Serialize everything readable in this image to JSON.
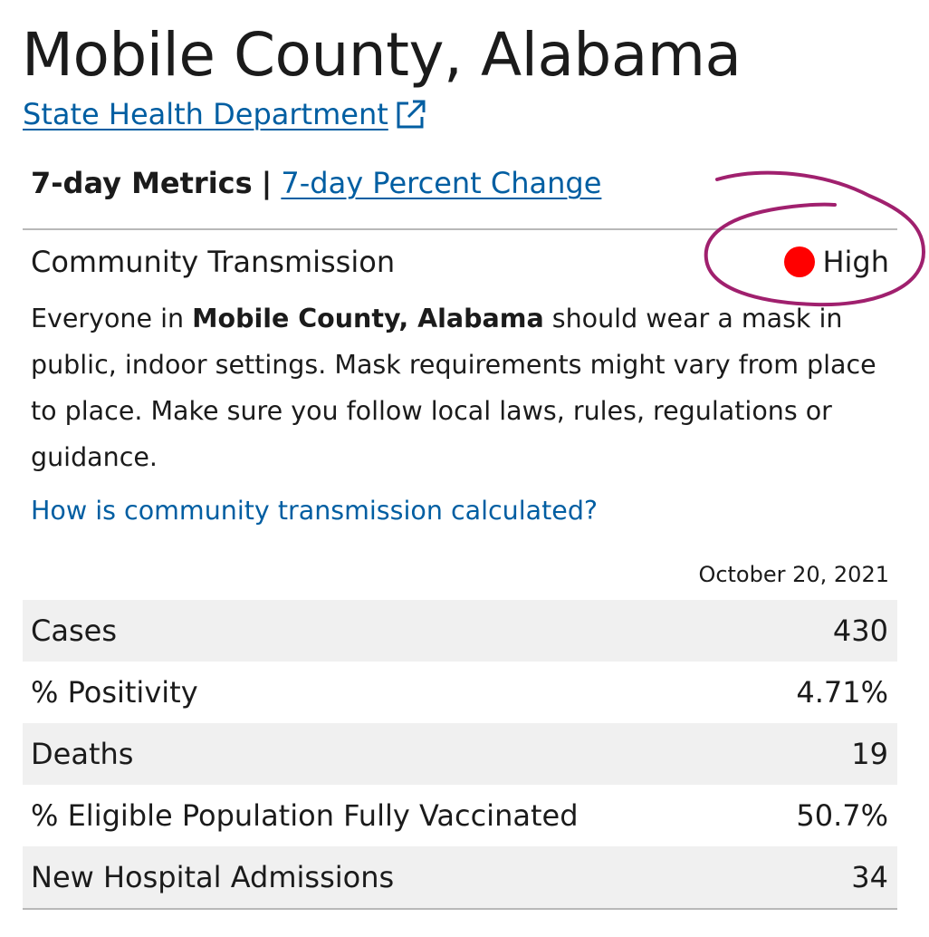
{
  "header": {
    "title": "Mobile County, Alabama",
    "state_link": "State Health Department"
  },
  "tabs": {
    "active": "7-day Metrics",
    "separator": "|",
    "link": "7-day Percent Change"
  },
  "transmission": {
    "label": "Community Transmission",
    "level": "High",
    "level_color": "#ff0000",
    "guidance": {
      "prefix": "Everyone in ",
      "county": "Mobile County, Alabama",
      "suffix": " should wear a mask in public, indoor settings. Mask requirements might vary from place to place. Make sure you follow local laws, rules, regulations or guidance."
    },
    "calc_link": "How is community transmission calculated?"
  },
  "metrics": {
    "date": "October 20, 2021",
    "rows": [
      {
        "label": "Cases",
        "value": "430"
      },
      {
        "label": "% Positivity",
        "value": "4.71%"
      },
      {
        "label": "Deaths",
        "value": "19"
      },
      {
        "label": "% Eligible Population Fully Vaccinated",
        "value": "50.7%"
      },
      {
        "label": "New Hospital Admissions",
        "value": "34"
      }
    ]
  },
  "colors": {
    "link": "#005ea2",
    "annotation": "#a0206e",
    "row_shade": "#f0f0f0"
  },
  "icons": {
    "external_link": "external-link-icon"
  }
}
